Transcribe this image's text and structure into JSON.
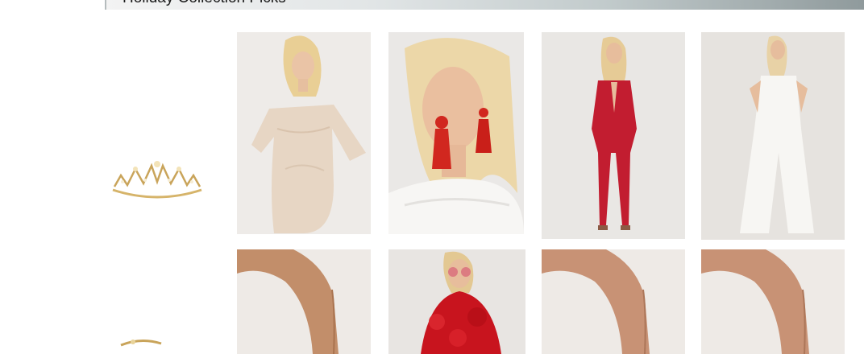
{
  "header": {
    "title": "Holiday Collection Picks"
  },
  "accessories": [
    {
      "name": "tiara",
      "kind": "gold-crown-tiara"
    },
    {
      "name": "accessory-partial",
      "kind": "gold-accessory"
    }
  ],
  "products": [
    {
      "name": "lace-off-shoulder-romper",
      "color": "#e6d7c6"
    },
    {
      "name": "red-tassel-earrings",
      "color": "#d1271f"
    },
    {
      "name": "red-plunge-jumpsuit",
      "color": "#c21d30"
    },
    {
      "name": "white-halter-jumpsuit",
      "color": "#f5f3ef"
    },
    {
      "name": "nude-heels",
      "color": "#c28e6a"
    },
    {
      "name": "red-fur-coat",
      "color": "#c8141e"
    },
    {
      "name": "nude-heels-alt",
      "color": "#c89275"
    },
    {
      "name": "nude-heels-alt-2",
      "color": "#c89275"
    }
  ]
}
